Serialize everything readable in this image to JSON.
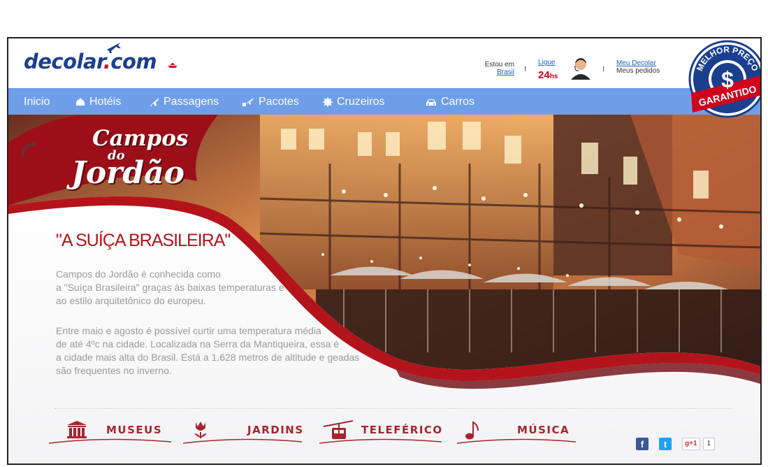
{
  "logo": {
    "text_main": "decolar",
    "text_dot": ".",
    "text_tail": "com"
  },
  "header": {
    "location_label": "Estou em",
    "location_link": "Brasil",
    "call_link": "Ligue",
    "call_hours": "24",
    "call_hours_suffix": "hs",
    "account_link": "Meu Decolar",
    "orders_label": "Meus pedidos",
    "separator": "I"
  },
  "nav": {
    "items": [
      {
        "label": "Inicio",
        "icon": "home"
      },
      {
        "label": "Hotéis",
        "icon": "bell-icon"
      },
      {
        "label": "Passagens",
        "icon": "plane-icon"
      },
      {
        "label": "Pacotes",
        "icon": "package-plane-icon"
      },
      {
        "label": "Cruzeiros",
        "icon": "ship-wheel-icon"
      },
      {
        "label": "Carros",
        "icon": "car-icon"
      }
    ]
  },
  "badge": {
    "top_text": "MELHOR PREÇO",
    "bottom_text": "GARANTIDO",
    "symbol": "$"
  },
  "hero": {
    "title_line1": "Campos",
    "title_line2": "do",
    "title_line3": "Jordão",
    "headline": "\"A SUÍÇA BRASILEIRA\"",
    "para1": [
      "Campos do Jordão é conhecida como",
      "a \"Suíça Brasileira\" graças às baixas temperaturas e",
      "ao estilo arquitetônico do europeu."
    ],
    "para2": [
      "Entre maio e agosto é possível curtir uma temperatura média",
      "de até 4ºc na cidade. Localizada na Serra da Mantiqueira, essa é",
      "a cidade mais alta do Brasil. Está a 1.628 metros de altitude e geadas",
      "são frequentes no inverno."
    ]
  },
  "categories": [
    {
      "label": "MUSEUS",
      "icon": "museum-icon"
    },
    {
      "label": "JARDINS",
      "icon": "tulip-icon"
    },
    {
      "label": "TELEFÉRICO",
      "icon": "cable-car-icon"
    },
    {
      "label": "MÚSICA",
      "icon": "music-note-icon"
    }
  ],
  "social": {
    "facebook": "f",
    "twitter": "t",
    "gplus": "g+1",
    "gplus_count": "1"
  },
  "colors": {
    "brand_blue": "#1b3f8f",
    "nav_blue": "#6e9eea",
    "accent_red": "#b3141b",
    "call_red": "#d0021b"
  }
}
